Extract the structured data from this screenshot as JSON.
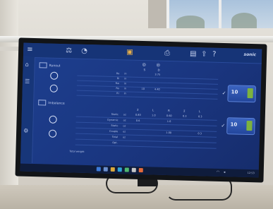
{
  "toolbar": {
    "left_icons": [
      "menu-icon",
      "balance-icon",
      "gauge-icon"
    ],
    "center_icon": "wheel-weight-icon",
    "right_icons": [
      "printer-icon",
      "save-icon",
      "share-icon",
      "help-icon"
    ],
    "brand": "sonic"
  },
  "sections": [
    {
      "label": "Runout",
      "icon": "vehicle-front-icon"
    },
    {
      "label": "Imbalance",
      "icon": "vehicle-rear-icon"
    }
  ],
  "runout_table": {
    "columns": [
      "S",
      "D"
    ],
    "rows": [
      {
        "label": "Ro",
        "unit": "in",
        "values": [
          "",
          "3.75"
        ]
      },
      {
        "label": "Ri",
        "unit": "in",
        "values": [
          "",
          ""
        ]
      },
      {
        "label": "Rw",
        "unit": "in",
        "values": [
          "",
          ""
        ]
      },
      {
        "label": "Ro",
        "unit": "in",
        "values": [
          "10",
          "4.40"
        ]
      },
      {
        "label": "Ri",
        "unit": "in",
        "values": [
          "",
          ""
        ]
      }
    ]
  },
  "imbalance_table": {
    "columns": [
      "Σ",
      "L",
      "R",
      "Σ",
      "L"
    ],
    "rows": [
      {
        "label": "Static",
        "unit": "oz",
        "values": [
          "0.83",
          "1.0",
          "0.60",
          "0.3",
          "0.3"
        ]
      },
      {
        "label": "Dynamic",
        "unit": "oz",
        "values": [
          "0.6",
          "",
          "1.0",
          "",
          ""
        ]
      },
      {
        "label": "Static",
        "unit": "oz",
        "values": [
          "",
          "",
          "",
          "",
          ""
        ]
      },
      {
        "label": "Couple",
        "unit": "oz",
        "values": [
          "",
          "",
          "1.00",
          "",
          "0.3"
        ]
      },
      {
        "label": "Total",
        "unit": "oz",
        "values": [
          "",
          "",
          "",
          "",
          ""
        ]
      },
      {
        "label": "Opt.",
        "unit": "",
        "values": [
          "",
          "",
          "",
          "",
          ""
        ]
      }
    ],
    "footer": "Total weight"
  },
  "right_cards": [
    {
      "value": "10",
      "check": "✓"
    },
    {
      "value": "10",
      "check": "✓"
    }
  ],
  "taskbar": {
    "clock": "12:53"
  },
  "colors": {
    "screen_bg": "#1a3680",
    "accent": "#e8b04a",
    "card_tag": "#7db23e"
  }
}
